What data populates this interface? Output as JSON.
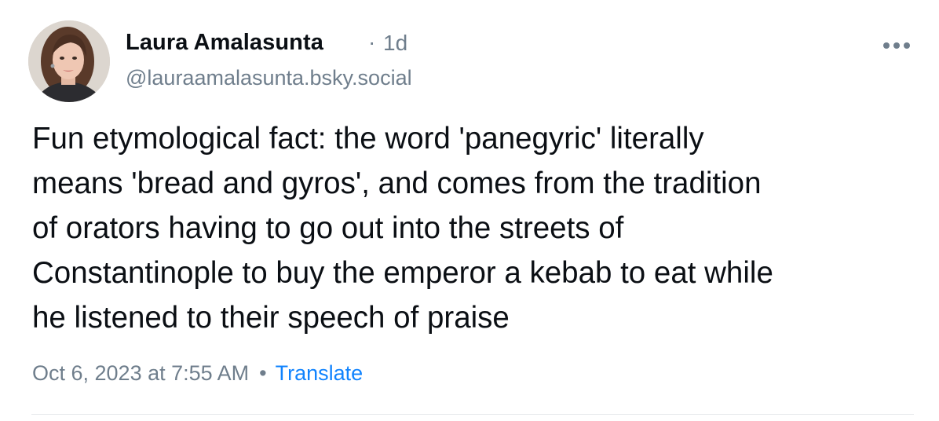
{
  "author": {
    "display_name": "Laura Amalasunta",
    "handle": "@lauraamalasunta.bsky.social",
    "relative_time": "1d",
    "meta_separator": "·"
  },
  "post": {
    "text": "Fun etymological fact: the word 'panegyric' literally\nmeans 'bread and gyros', and comes from the tradition\nof orators having to go out into the streets of\nConstantinople to buy the emperor a kebab to eat while\nhe listened to their speech of praise",
    "timestamp": "Oct 6, 2023 at 7:55 AM",
    "footer_separator": "•",
    "translate_label": "Translate"
  },
  "icons": {
    "more": "more-horizontal-icon",
    "avatar": "profile-photo"
  },
  "colors": {
    "text": "#0b0f14",
    "muted": "#6f7e8c",
    "link": "#1083fe",
    "divider": "#e6e9ec"
  }
}
